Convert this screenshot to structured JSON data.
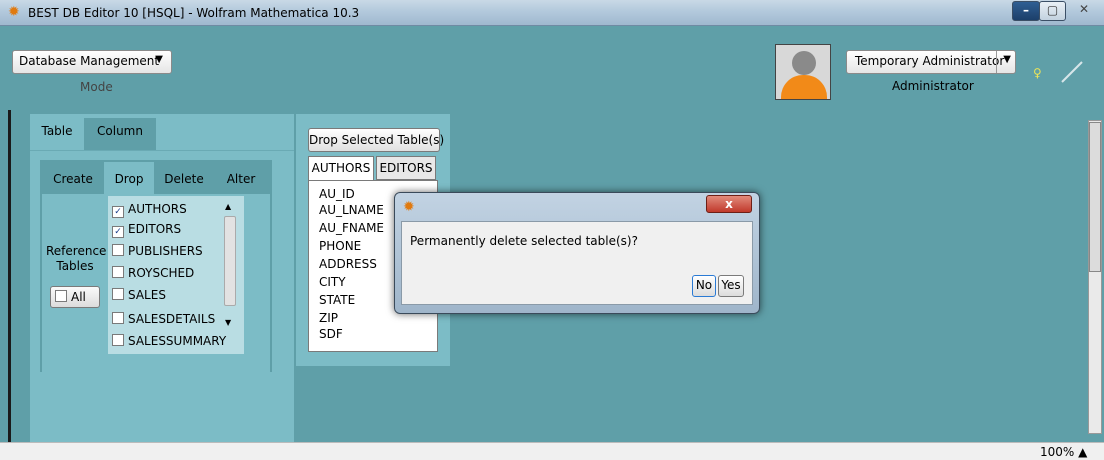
{
  "window": {
    "title": "BEST DB Editor 10 [HSQL] - Wolfram Mathematica 10.3",
    "min": "–",
    "max": "▢",
    "close": "✕"
  },
  "header": {
    "mode_value": "Database Management",
    "mode_label": "Mode",
    "user_value": "Temporary Administrator",
    "role_label": "Administrator"
  },
  "left": {
    "tabs": [
      "Table",
      "Column"
    ],
    "subtabs": [
      "Create",
      "Drop",
      "Delete",
      "Alter"
    ],
    "reference_label": "Reference Tables",
    "all_label": "All",
    "tables": [
      {
        "name": "AUTHORS",
        "checked": true
      },
      {
        "name": "EDITORS",
        "checked": true
      },
      {
        "name": "PUBLISHERS",
        "checked": false
      },
      {
        "name": "ROYSCHED",
        "checked": false
      },
      {
        "name": "SALES",
        "checked": false
      },
      {
        "name": "SALESDETAILS",
        "checked": false
      },
      {
        "name": "SALESSUMMARY",
        "checked": false
      }
    ]
  },
  "middle": {
    "drop_button": "Drop Selected Table(s)",
    "tabs": [
      "AUTHORS",
      "EDITORS"
    ],
    "columns": [
      "AU_ID",
      "AU_LNAME",
      "AU_FNAME",
      "PHONE",
      "ADDRESS",
      "CITY",
      "STATE",
      "ZIP",
      "SDF"
    ]
  },
  "dialog": {
    "message": "Permanently delete selected table(s)?",
    "no_label": "No",
    "yes_label": "Yes",
    "close_label": "x"
  },
  "status": {
    "zoom": "100% ▲"
  },
  "colors": {
    "background": "#5f9fa8",
    "panel": "#7cbcc6",
    "avatar_body": "#f28a18"
  }
}
